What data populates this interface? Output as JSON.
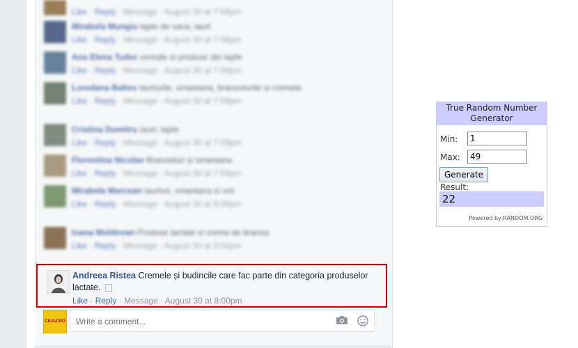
{
  "feed": {
    "blurred_comments": [
      {
        "name": "",
        "text": "",
        "actions": [
          "Like",
          "Reply",
          "Message",
          "August 30 at 7:58pm"
        ]
      },
      {
        "name": "Mirabela Mungiu",
        "text": "lapte de vaca, iaurt",
        "actions": [
          "Like",
          "Reply",
          "Message",
          "August 30 at 7:58pm"
        ]
      },
      {
        "name": "Ana Elena Tudor",
        "text": "cereale si produse din lapte",
        "actions": [
          "Like",
          "Reply",
          "Message",
          "August 30 at 7:58pm"
        ]
      },
      {
        "name": "",
        "text": "",
        "actions": [
          "Like",
          "Reply",
          "Message",
          "August 30 at 7:59pm"
        ]
      },
      {
        "name": "Loredana Baltes",
        "text": "Iaurturile, smantana, branzeturile si cremele",
        "actions": [
          "Like",
          "Reply",
          "Message",
          "August 30 at 7:59pm"
        ]
      },
      {
        "name": "Cristina Dumitru",
        "text": "Iaurt, lapte",
        "actions": [
          "Like",
          "Reply",
          "Message",
          "August 30 at 7:59pm"
        ]
      },
      {
        "name": "Florentina Nicolae",
        "text": "Branzeturi si smantana",
        "actions": [
          "Like",
          "Reply",
          "Message",
          "August 30 at 7:59pm"
        ]
      },
      {
        "name": "Mirabela Marcean",
        "text": "Iaurturi, smantana si unt",
        "actions": [
          "Like",
          "Reply",
          "Message",
          "August 30 at 8:00pm"
        ]
      },
      {
        "name": "Ioana Moldovan",
        "text": "Produse lactate si crema de branza",
        "actions": [
          "Like",
          "Reply",
          "Message",
          "August 30 at 8:00pm"
        ]
      }
    ],
    "highlighted_comment": {
      "name": "Andreea Ristea",
      "text": "Cremele și budincile care fac parte din categoria produselor lactate.",
      "like": "Like",
      "reply": "Reply",
      "message": "Message",
      "timestamp": "August 30 at 8:00pm"
    },
    "composer": {
      "page_logo_text": "CEJACRO",
      "placeholder": "Write a comment..."
    }
  },
  "rng": {
    "title": "True Random Number Generator",
    "min_label": "Min:",
    "min_value": "1",
    "max_label": "Max:",
    "max_value": "49",
    "button_label": "Generate",
    "result_label": "Result:",
    "result_value": "22",
    "powered_by": "Powered by RANDOM.ORG"
  },
  "colors": {
    "highlight_border": "#d40000",
    "link": "#365899",
    "rng_accent": "#ccccff"
  }
}
